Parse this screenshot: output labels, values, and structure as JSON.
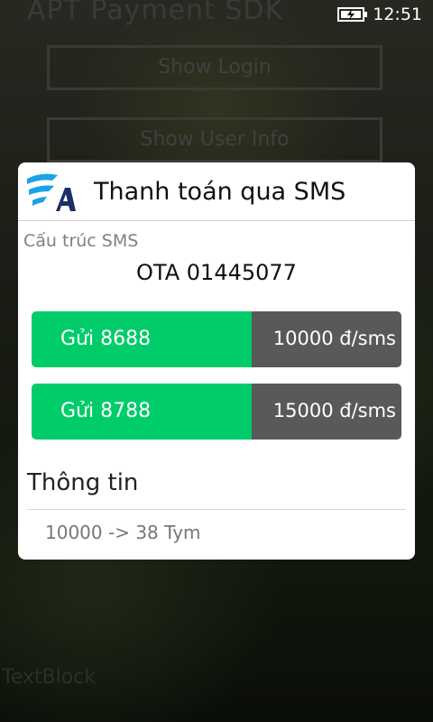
{
  "status_bar": {
    "time": "12:51",
    "battery_icon": "battery-charging-icon"
  },
  "background": {
    "title": "APT Payment SDK",
    "buttons": [
      "Show Login",
      "Show User Info"
    ],
    "textblock": "TextBlock"
  },
  "dialog": {
    "logo_icon": "app-logo-icon",
    "title": "Thanh toán qua SMS",
    "structure_label": "Cấu trúc SMS",
    "sms_code": "OTA 01445077",
    "options": [
      {
        "label": "Gửi 8688",
        "price": "10000 đ/sms"
      },
      {
        "label": "Gửi 8788",
        "price": "15000 đ/sms"
      }
    ],
    "info_title": "Thông tin",
    "info_line": "10000 -> 38 Tym"
  },
  "colors": {
    "accent_green": "#00cc6a",
    "price_bg": "#58595b",
    "logo_blue": "#1aa3e8"
  }
}
